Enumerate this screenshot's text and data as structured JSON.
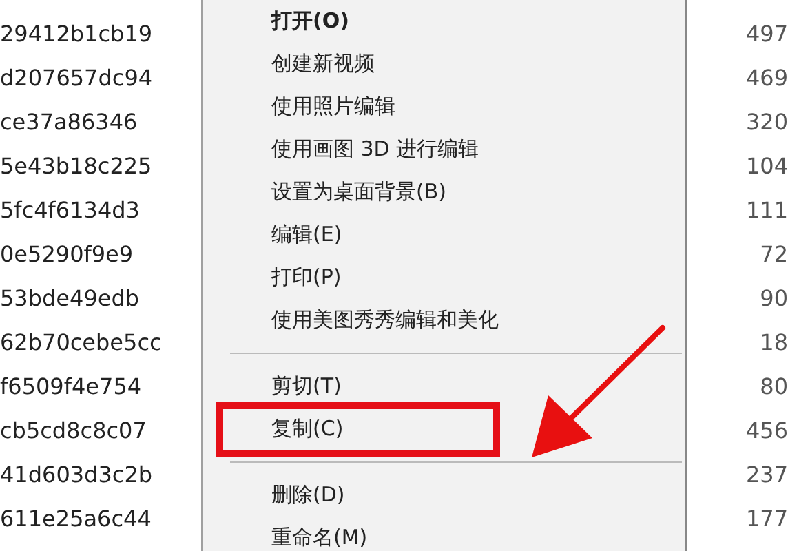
{
  "file_names": [
    "29412b1cb19",
    "d207657dc94",
    "ce37a86346",
    "5e43b18c225",
    "5fc4f6134d3",
    "0e5290f9e9",
    "53bde49edb",
    "62b70cebe5cc",
    "f6509f4e754",
    "cb5cd8c8c07",
    "41d603d3c2b",
    "611e25a6c44"
  ],
  "file_sizes": [
    "497",
    "469",
    "320",
    "104",
    "111",
    "72",
    "90",
    "18",
    "80",
    "456",
    "237",
    "177"
  ],
  "context_menu": [
    {
      "kind": "item",
      "label": "打开(O)",
      "default": true,
      "highlighted": false
    },
    {
      "kind": "item",
      "label": "创建新视频",
      "default": false,
      "highlighted": false
    },
    {
      "kind": "item",
      "label": "使用照片编辑",
      "default": false,
      "highlighted": false
    },
    {
      "kind": "item",
      "label": "使用画图 3D 进行编辑",
      "default": false,
      "highlighted": false
    },
    {
      "kind": "item",
      "label": "设置为桌面背景(B)",
      "default": false,
      "highlighted": false
    },
    {
      "kind": "item",
      "label": "编辑(E)",
      "default": false,
      "highlighted": false
    },
    {
      "kind": "item",
      "label": "打印(P)",
      "default": false,
      "highlighted": false
    },
    {
      "kind": "item",
      "label": "使用美图秀秀编辑和美化",
      "default": false,
      "highlighted": false
    },
    {
      "kind": "separator"
    },
    {
      "kind": "item",
      "label": "剪切(T)",
      "default": false,
      "highlighted": false
    },
    {
      "kind": "item",
      "label": "复制(C)",
      "default": false,
      "highlighted": true
    },
    {
      "kind": "separator"
    },
    {
      "kind": "item",
      "label": "删除(D)",
      "default": false,
      "highlighted": false
    },
    {
      "kind": "item",
      "label": "重命名(M)",
      "default": false,
      "highlighted": false
    }
  ]
}
